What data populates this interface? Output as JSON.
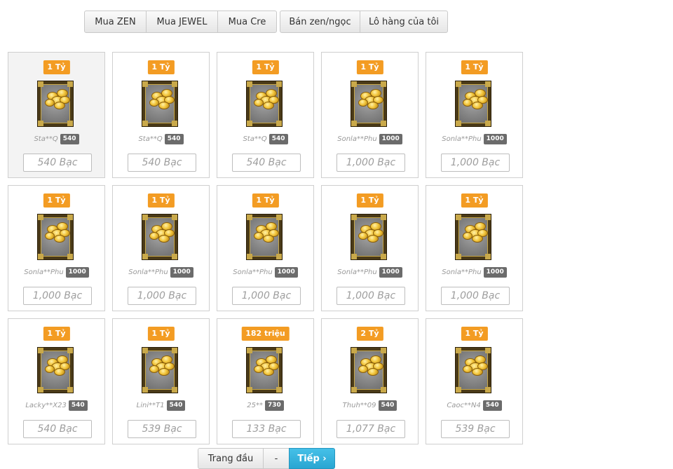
{
  "buy_tabs": [
    {
      "label": "Mua ZEN"
    },
    {
      "label": "Mua JEWEL"
    },
    {
      "label": "Mua Cre"
    }
  ],
  "sell_tabs": [
    {
      "label": "Bán zen/ngọc"
    },
    {
      "label": "Lô hàng của tôi"
    }
  ],
  "items": [
    {
      "amount": "1 Tỷ",
      "seller": "Sta**Q",
      "level": "540",
      "price": "540 Bạc",
      "selected": true
    },
    {
      "amount": "1 Tỷ",
      "seller": "Sta**Q",
      "level": "540",
      "price": "540 Bạc"
    },
    {
      "amount": "1 Tỷ",
      "seller": "Sta**Q",
      "level": "540",
      "price": "540 Bạc"
    },
    {
      "amount": "1 Tỷ",
      "seller": "Sonla**Phu",
      "level": "1000",
      "price": "1,000 Bạc"
    },
    {
      "amount": "1 Tỷ",
      "seller": "Sonla**Phu",
      "level": "1000",
      "price": "1,000 Bạc"
    },
    {
      "amount": "1 Tỷ",
      "seller": "Sonla**Phu",
      "level": "1000",
      "price": "1,000 Bạc"
    },
    {
      "amount": "1 Tỷ",
      "seller": "Sonla**Phu",
      "level": "1000",
      "price": "1,000 Bạc"
    },
    {
      "amount": "1 Tỷ",
      "seller": "Sonla**Phu",
      "level": "1000",
      "price": "1,000 Bạc"
    },
    {
      "amount": "1 Tỷ",
      "seller": "Sonla**Phu",
      "level": "1000",
      "price": "1,000 Bạc"
    },
    {
      "amount": "1 Tỷ",
      "seller": "Sonla**Phu",
      "level": "1000",
      "price": "1,000 Bạc"
    },
    {
      "amount": "1 Tỷ",
      "seller": "Lacky**X23",
      "level": "540",
      "price": "540 Bạc"
    },
    {
      "amount": "1 Tỷ",
      "seller": "Lini**T1",
      "level": "540",
      "price": "539 Bạc"
    },
    {
      "amount": "182 triệu",
      "seller": "25**",
      "level": "730",
      "price": "133 Bạc"
    },
    {
      "amount": "2 Tỷ",
      "seller": "Thuh**09",
      "level": "540",
      "price": "1,077 Bạc"
    },
    {
      "amount": "1 Tỷ",
      "seller": "Caoc**N4",
      "level": "540",
      "price": "539 Bạc"
    }
  ],
  "pagination": {
    "first_label": "Trang đầu",
    "middle_label": "-",
    "next_label": "Tiếp ›"
  },
  "colors": {
    "amount_badge": "#f39c23",
    "level_badge": "#6b6b6b",
    "next_button": "#2aa6d2"
  },
  "icons": {
    "item": "zen-coin-pile-icon"
  }
}
